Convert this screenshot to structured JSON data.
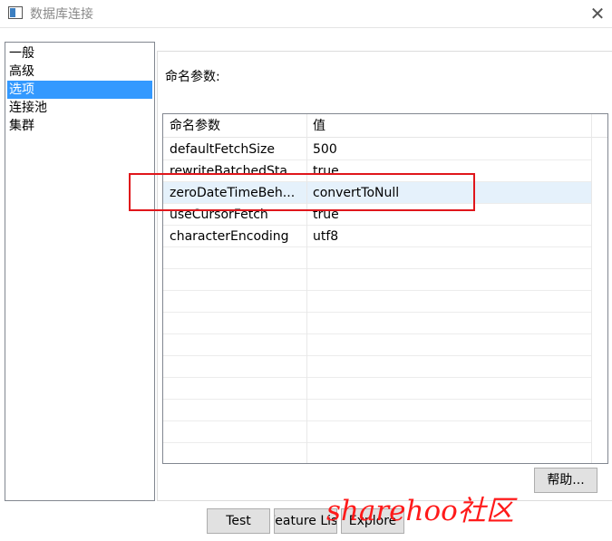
{
  "window": {
    "title": "数据库连接",
    "close_icon": "close-icon",
    "app_icon": "window-icon"
  },
  "nav": {
    "items": [
      {
        "label": "一般",
        "selected": false
      },
      {
        "label": "高级",
        "selected": false
      },
      {
        "label": "选项",
        "selected": true
      },
      {
        "label": "连接池",
        "selected": false
      },
      {
        "label": "集群",
        "selected": false
      }
    ]
  },
  "options": {
    "params_label": "命名参数:",
    "table": {
      "headers": [
        "命名参数",
        "值"
      ],
      "rows": [
        {
          "name": "defaultFetchSize",
          "value": "500",
          "selected": false
        },
        {
          "name": "rewriteBatchedSta...",
          "value": "true",
          "selected": false
        },
        {
          "name": "zeroDateTimeBeh...",
          "value": "convertToNull",
          "selected": true
        },
        {
          "name": "useCursorFetch",
          "value": "true",
          "selected": false
        },
        {
          "name": "characterEncoding",
          "value": "utf8",
          "selected": false
        }
      ]
    },
    "help_label": "帮助..."
  },
  "footer": {
    "test_label": "Test",
    "feature_list_label": "Feature List",
    "explore_label": "Explore"
  },
  "overlay": {
    "watermark": "sharehoo社区",
    "highlight_color": "#e0161b"
  },
  "colors": {
    "selection": "#3399ff",
    "row_selected": "#e5f1fb"
  }
}
